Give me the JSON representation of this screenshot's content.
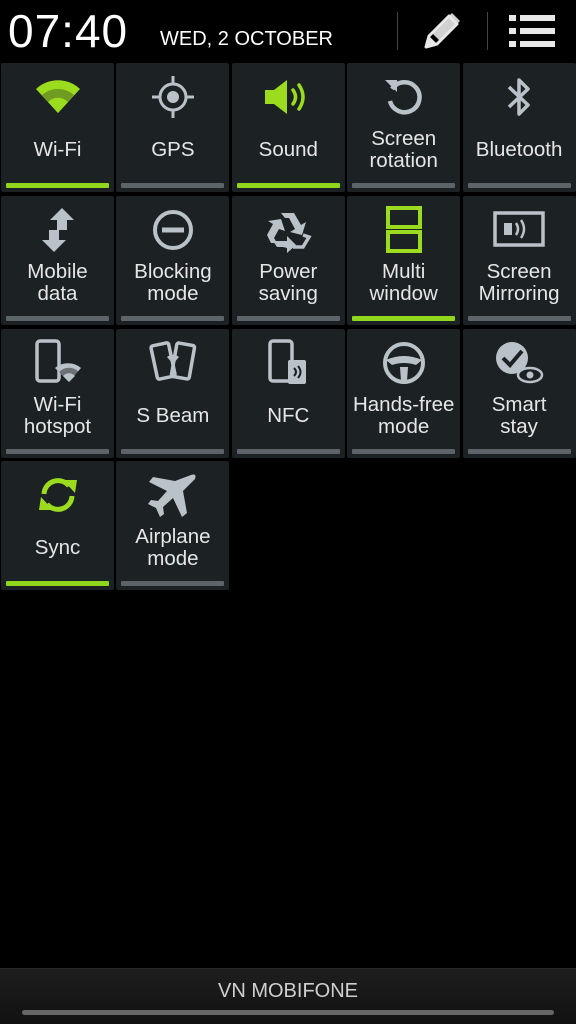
{
  "status": {
    "time": "07:40",
    "date": "WED, 2 OCTOBER"
  },
  "header": {
    "edit_icon": "pencil-icon",
    "menu_icon": "list-icon"
  },
  "colors": {
    "active": "#9bdc1f",
    "inactive_icon": "#b9c2c8",
    "tile_bg": "#1c2124",
    "bar_off": "#5c646a",
    "bar_on": "#8fd61c"
  },
  "toggles": [
    {
      "label": "Wi-Fi",
      "icon": "wifi-icon",
      "on": true
    },
    {
      "label": "GPS",
      "icon": "gps-icon",
      "on": false
    },
    {
      "label": "Sound",
      "icon": "sound-icon",
      "on": true
    },
    {
      "label": "Screen\nrotation",
      "icon": "rotation-icon",
      "on": false
    },
    {
      "label": "Bluetooth",
      "icon": "bluetooth-icon",
      "on": false
    },
    {
      "label": "Mobile\ndata",
      "icon": "mobile-data-icon",
      "on": false
    },
    {
      "label": "Blocking\nmode",
      "icon": "blocking-icon",
      "on": false
    },
    {
      "label": "Power\nsaving",
      "icon": "recycle-icon",
      "on": false
    },
    {
      "label": "Multi\nwindow",
      "icon": "multi-window-icon",
      "on": true
    },
    {
      "label": "Screen\nMirroring",
      "icon": "screen-mirroring-icon",
      "on": false
    },
    {
      "label": "Wi-Fi\nhotspot",
      "icon": "hotspot-icon",
      "on": false
    },
    {
      "label": "S Beam",
      "icon": "s-beam-icon",
      "on": false
    },
    {
      "label": "NFC",
      "icon": "nfc-icon",
      "on": false
    },
    {
      "label": "Hands-free\nmode",
      "icon": "steering-wheel-icon",
      "on": false
    },
    {
      "label": "Smart\nstay",
      "icon": "smart-stay-icon",
      "on": false
    },
    {
      "label": "Sync",
      "icon": "sync-icon",
      "on": true
    },
    {
      "label": "Airplane\nmode",
      "icon": "airplane-icon",
      "on": false
    }
  ],
  "footer": {
    "carrier": "VN MOBIFONE"
  }
}
